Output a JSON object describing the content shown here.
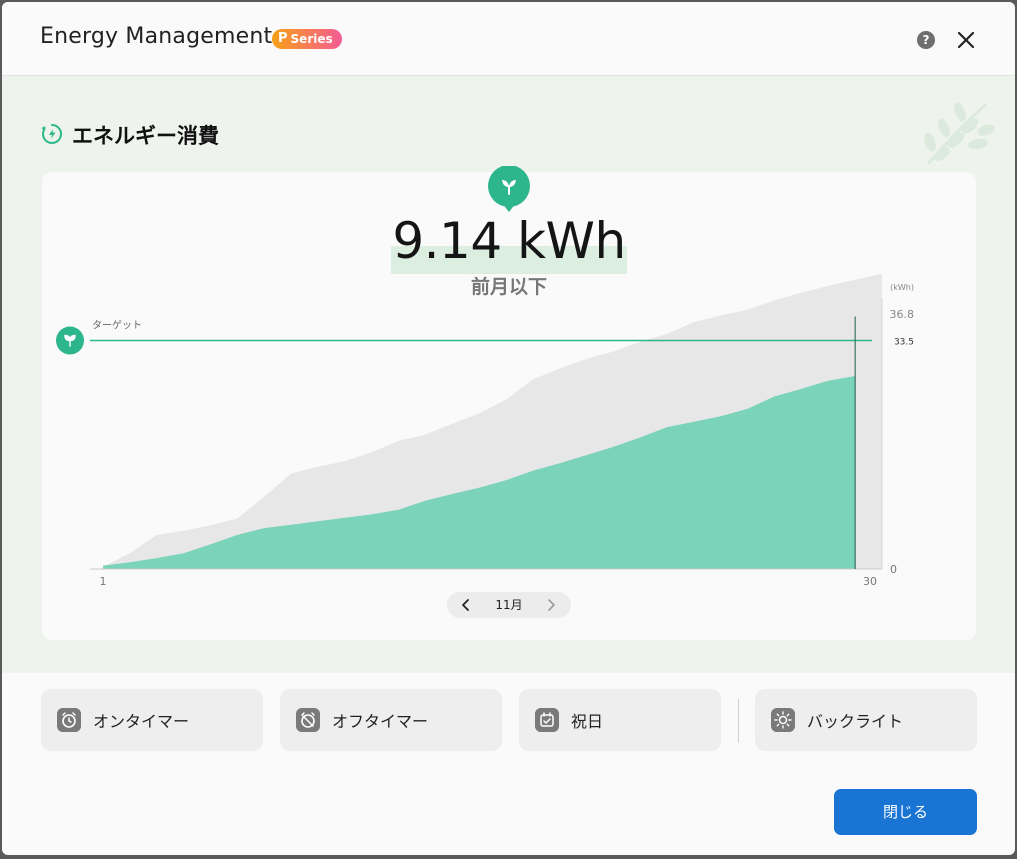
{
  "header": {
    "title": "Energy Management",
    "badge_letter": "P",
    "badge_text": "Series",
    "help_label": "?"
  },
  "section": {
    "title": "エネルギー消費"
  },
  "summary": {
    "value": "9.14 kWh",
    "comparison": "前月以下"
  },
  "colors": {
    "accent": "#2db58c",
    "fill_current": "#7bd3b9",
    "fill_previous": "#e7e7e7",
    "primary_button": "#1a74d4"
  },
  "chart_data": {
    "type": "area",
    "unit": "(kWh)",
    "x_tick_labels": [
      "1",
      "30"
    ],
    "xlim": [
      1,
      30
    ],
    "y_tick_labels": [
      "0",
      "36.8"
    ],
    "ylim": [
      0,
      36.8
    ],
    "target_label": "ターゲット",
    "target_value": 33.5,
    "target_value_label": "33.5",
    "current_day": 29,
    "series": [
      {
        "values": [
          0.5,
          1.0,
          1.6,
          2.3,
          3.6,
          5.0,
          6.0,
          6.5,
          7.0,
          7.5,
          8.0,
          8.7,
          10.0,
          11.0,
          11.9,
          13.0,
          14.4,
          15.5,
          16.7,
          17.9,
          19.3,
          20.8,
          21.6,
          22.4,
          23.5,
          25.3,
          26.4,
          27.6,
          28.3
        ]
      },
      {
        "values": [
          0.3,
          2.3,
          5.0,
          5.6,
          6.4,
          7.4,
          10.6,
          14.0,
          15.0,
          15.8,
          17.1,
          18.8,
          19.7,
          21.3,
          22.8,
          24.8,
          27.8,
          29.4,
          30.8,
          31.9,
          33.3,
          34.5,
          36.2,
          37.2,
          38.0,
          39.4,
          40.5,
          41.5,
          42.4,
          43.3
        ]
      }
    ]
  },
  "nav": {
    "month": "11月"
  },
  "footer": {
    "on_timer": "オンタイマー",
    "off_timer": "オフタイマー",
    "holiday": "祝日",
    "backlight": "バックライト",
    "close": "閉じる"
  }
}
